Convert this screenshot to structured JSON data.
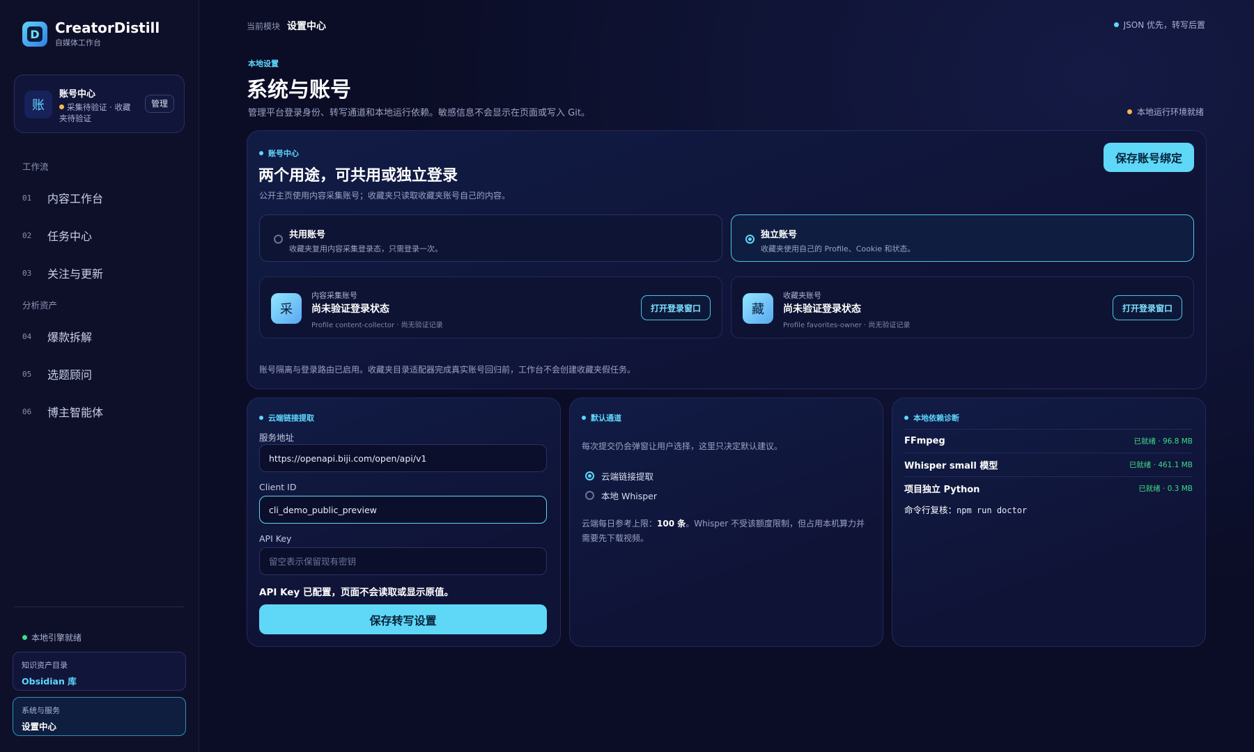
{
  "brand": {
    "name": "CreatorDistill",
    "subtitle": "自媒体工作台",
    "logo_letter": "D"
  },
  "account_card": {
    "avatar": "账",
    "title": "账号中心",
    "status": "采集待验证 · 收藏夹待验证",
    "manage_label": "管理",
    "status_color": "#f5b94a"
  },
  "nav": {
    "groups": [
      {
        "label": "工作流",
        "items": [
          {
            "num": "01",
            "label": "内容工作台"
          },
          {
            "num": "02",
            "label": "任务中心"
          },
          {
            "num": "03",
            "label": "关注与更新"
          }
        ]
      },
      {
        "label": "分析资产",
        "items": [
          {
            "num": "04",
            "label": "爆款拆解"
          },
          {
            "num": "05",
            "label": "选题顾问"
          },
          {
            "num": "06",
            "label": "博主智能体"
          }
        ]
      }
    ]
  },
  "sidebar_footer": {
    "engine_status": "本地引擎就绪",
    "cards": [
      {
        "label": "知识资产目录",
        "value": "Obsidian 库"
      },
      {
        "label": "系统与服务",
        "value": "设置中心"
      }
    ]
  },
  "header": {
    "crumb_label": "当前模块",
    "crumb_current": "设置中心",
    "right_status": "JSON 优先，转写后置"
  },
  "page": {
    "eyebrow": "本地设置",
    "title": "系统与账号",
    "description": "管理平台登录身份、转写通道和本地运行依赖。敏感信息不会显示在页面或写入 Git。",
    "env_status": "本地运行环境就绪"
  },
  "account_panel": {
    "eyebrow": "账号中心",
    "title": "两个用途，可共用或独立登录",
    "description": "公开主页使用内容采集账号；收藏夹只读取收藏夹账号自己的内容。",
    "save_label": "保存账号绑定",
    "modes": [
      {
        "title": "共用账号",
        "desc": "收藏夹复用内容采集登录态，只需登录一次。",
        "selected": false
      },
      {
        "title": "独立账号",
        "desc": "收藏夹使用自己的 Profile、Cookie 和状态。",
        "selected": true
      }
    ],
    "profiles": [
      {
        "icon": "采",
        "label": "内容采集账号",
        "state": "尚未验证登录状态",
        "meta": "Profile content-collector · 尚无验证记录",
        "button": "打开登录窗口"
      },
      {
        "icon": "藏",
        "label": "收藏夹账号",
        "state": "尚未验证登录状态",
        "meta": "Profile favorites-owner · 尚无验证记录",
        "button": "打开登录窗口"
      }
    ],
    "note": "账号隔离与登录路由已启用。收藏夹目录适配器完成真实账号回归前，工作台不会创建收藏夹假任务。"
  },
  "cloud_panel": {
    "eyebrow": "云端链接提取",
    "service_label": "服务地址",
    "service_value": "https://openapi.biji.com/open/api/v1",
    "client_label": "Client ID",
    "client_value": "cli_demo_public_preview",
    "apikey_label": "API Key",
    "apikey_placeholder": "留空表示保留现有密钥",
    "apikey_note": "API Key 已配置，页面不会读取或显示原值。",
    "save_label": "保存转写设置"
  },
  "channel_panel": {
    "eyebrow": "默认通道",
    "description": "每次提交仍会弹窗让用户选择，这里只决定默认建议。",
    "options": [
      {
        "label": "云端链接提取",
        "selected": true
      },
      {
        "label": "本地 Whisper",
        "selected": false
      }
    ],
    "note_prefix": "云端每日参考上限：",
    "note_limit": "100 条",
    "note_suffix": "。Whisper 不受该额度限制，但占用本机算力并需要先下载视频。"
  },
  "deps_panel": {
    "eyebrow": "本地依赖诊断",
    "items": [
      {
        "name": "FFmpeg",
        "state": "已就绪 · 96.8 MB"
      },
      {
        "name": "Whisper small 模型",
        "state": "已就绪 · 461.1 MB"
      },
      {
        "name": "项目独立 Python",
        "state": "已就绪 · 0.3 MB"
      }
    ],
    "cmd_label": "命令行复核：",
    "cmd": "npm run doctor"
  },
  "colors": {
    "accent": "#5fd8f7",
    "ok": "#3fdc8a",
    "warn": "#f5b94a",
    "bg": "#0b0d26"
  }
}
